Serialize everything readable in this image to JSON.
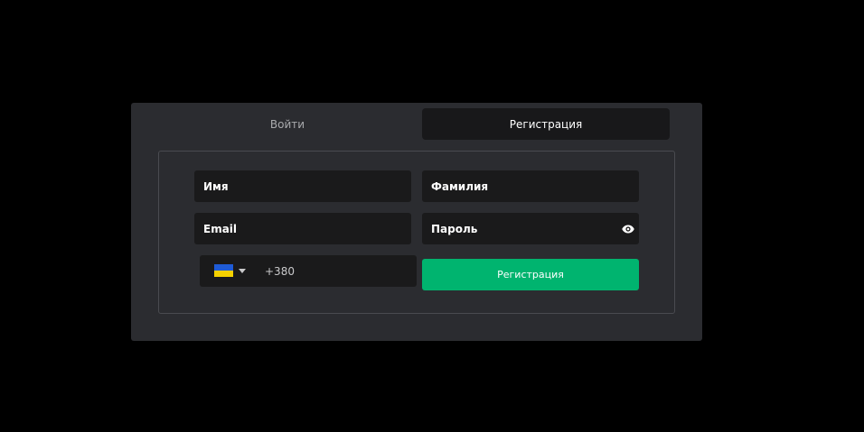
{
  "tabs": {
    "login_label": "Войти",
    "register_label": "Регистрация",
    "active": "register"
  },
  "form": {
    "first_name_placeholder": "Имя",
    "last_name_placeholder": "Фамилия",
    "email_placeholder": "Email",
    "password_placeholder": "Пароль",
    "phone": {
      "country": "UA",
      "flag_icon": "ukraine-flag-icon",
      "dial_code": "+380"
    },
    "submit_label": "Регистрация",
    "password_toggle_icon": "eye-icon"
  },
  "colors": {
    "page_background": "#000000",
    "modal_background": "#2b2c30",
    "field_background": "#1a1a1b",
    "accent": "#00b46f",
    "tab_inactive_text": "#a9aaad",
    "flag_blue": "#1f5bd6",
    "flag_yellow": "#f5d100"
  }
}
